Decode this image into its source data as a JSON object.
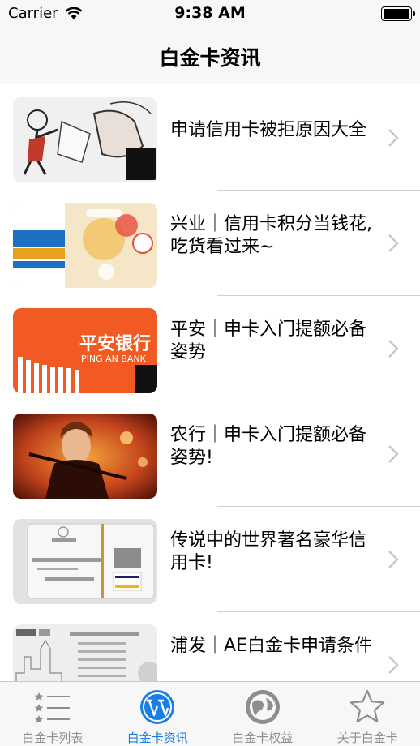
{
  "status_bar": {
    "carrier": "Carrier",
    "time": "9:38 AM"
  },
  "nav": {
    "title": "白金卡资讯"
  },
  "articles": [
    {
      "title": "申请信用卡被拒原因大全",
      "image": "cartoon-illustration"
    },
    {
      "title": "兴业｜信用卡积分当钱花,吃货看过来~",
      "image": "promo-banner"
    },
    {
      "title": "平安｜申卡入门提额必备姿势",
      "image": "pingan-bank-logo"
    },
    {
      "title": "农行｜申卡入门提额必备姿势!",
      "image": "movie-still"
    },
    {
      "title": "传说中的世界著名豪华信用卡!",
      "image": "credit-card-photo"
    },
    {
      "title": "浦发｜AE白金卡申请条件",
      "image": "document-photo"
    }
  ],
  "thumb_text": {
    "pingan_bank": "平安银行",
    "pingan_bank_en": "PING AN BANK"
  },
  "tabs": [
    {
      "label": "白金卡列表",
      "icon": "list-icon",
      "active": false
    },
    {
      "label": "白金卡资讯",
      "icon": "wordpress-icon",
      "active": true
    },
    {
      "label": "白金卡权益",
      "icon": "globe-icon",
      "active": false
    },
    {
      "label": "关于白金卡",
      "icon": "star-icon",
      "active": false
    }
  ],
  "colors": {
    "accent": "#1a7ee6",
    "tab_inactive": "#8e8e8e",
    "bar_bg": "#f7f7f7",
    "pingan_orange": "#f15a22"
  }
}
